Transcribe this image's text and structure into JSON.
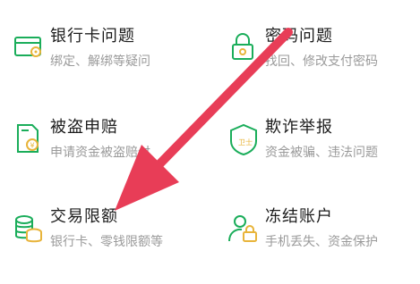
{
  "items": [
    {
      "title": "银行卡问题",
      "desc": "绑定、解绑等疑问",
      "icon": "bank-card-icon"
    },
    {
      "title": "密码问题",
      "desc": "找回、修改支付密码",
      "icon": "lock-icon"
    },
    {
      "title": "被盗申赔",
      "desc": "申请资金被盗赔付",
      "icon": "claim-document-icon"
    },
    {
      "title": "欺诈举报",
      "desc": "资金被骗、违法问题",
      "icon": "fraud-report-icon"
    },
    {
      "title": "交易限额",
      "desc": "银行卡、零钱限额等",
      "icon": "coin-stack-icon"
    },
    {
      "title": "冻结账户",
      "desc": "手机丢失、资金保护",
      "icon": "user-lock-icon"
    }
  ],
  "colors": {
    "icon_green": "#1aad5a",
    "icon_yellow": "#e8b43a",
    "arrow": "#e83d57"
  }
}
